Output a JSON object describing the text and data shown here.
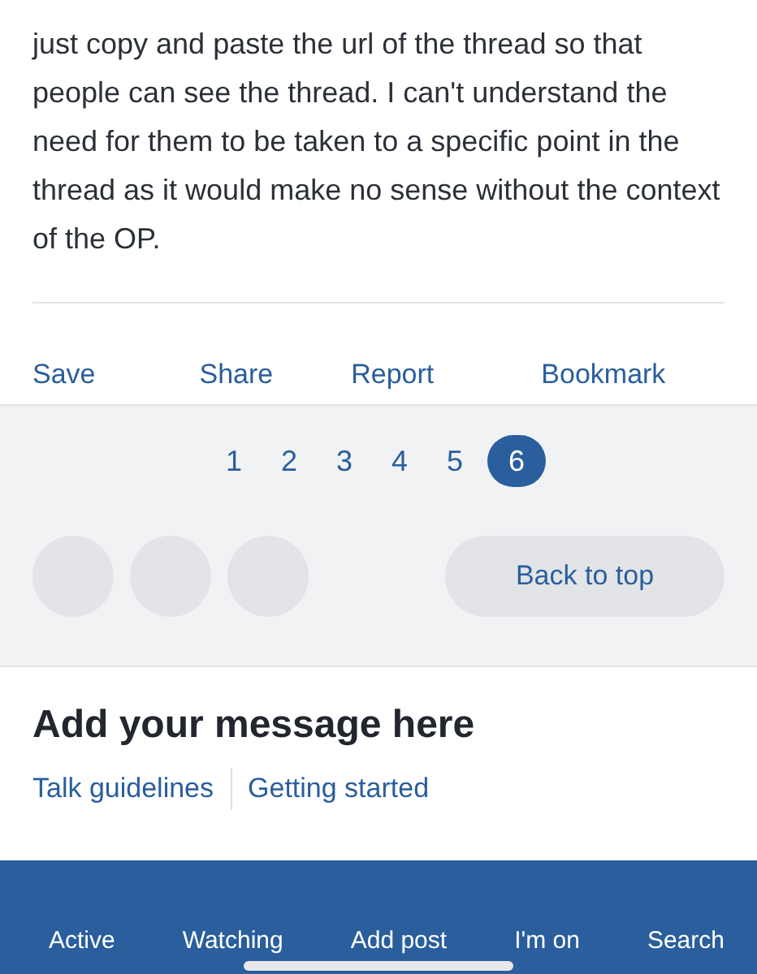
{
  "post": {
    "text": "just copy and paste the url of the thread so that people can see the thread. I can't understand the need for them to be taken to a specific point in the thread as it would make no sense without the context of the OP."
  },
  "post_actions": [
    "Save",
    "Share",
    "Report",
    "Bookmark"
  ],
  "pagination": [
    {
      "label": "1",
      "selected": false
    },
    {
      "label": "2",
      "selected": false
    },
    {
      "label": "3",
      "selected": false
    },
    {
      "label": "4",
      "selected": false
    },
    {
      "label": "5",
      "selected": false
    },
    {
      "label": "6",
      "selected": true
    }
  ],
  "back_to_top": "Back to top",
  "reply": {
    "title": "Add your message here",
    "links": [
      "Talk guidelines",
      "Getting started"
    ]
  },
  "bottom_nav": [
    "Active",
    "Watching",
    "Add post",
    "I'm on",
    "Search"
  ]
}
